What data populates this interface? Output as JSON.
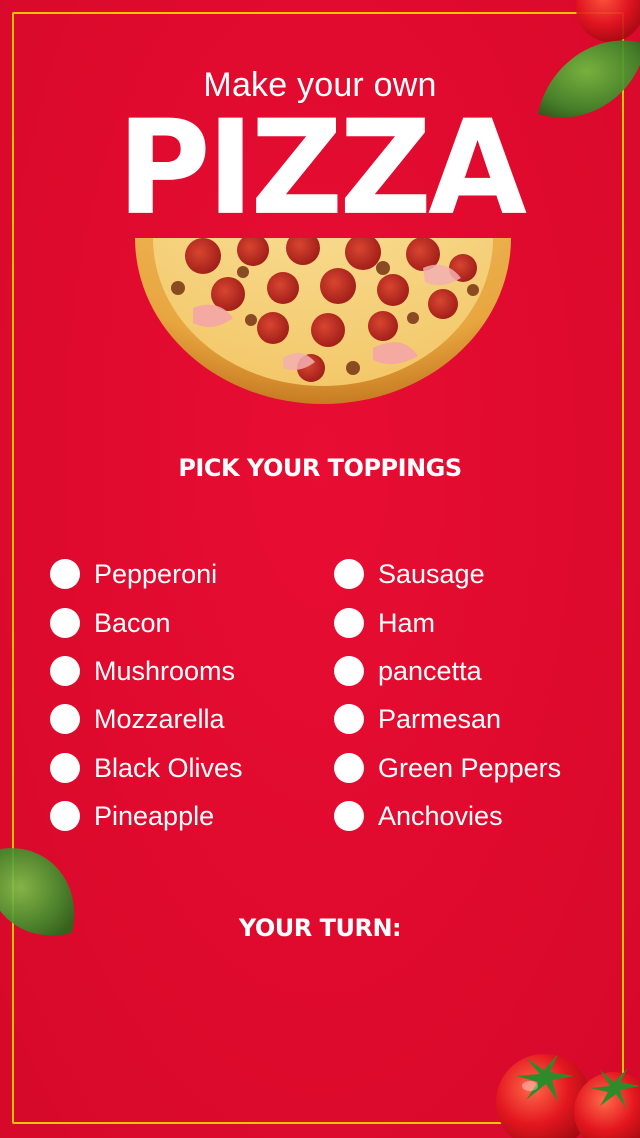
{
  "header": {
    "subtitle": "Make your own",
    "title": "PIZZA"
  },
  "toppings_heading": "PICK YOUR TOPPINGS",
  "toppings": {
    "left": [
      "Pepperoni",
      "Bacon",
      "Mushrooms",
      "Mozzarella",
      "Black Olives",
      "Pineapple"
    ],
    "right": [
      "Sausage",
      "Ham",
      "pancetta",
      "Parmesan",
      "Green Peppers",
      "Anchovies"
    ]
  },
  "your_turn_label": "YOUR TURN:",
  "colors": {
    "background": "#e10b2f",
    "frame": "#f5c400",
    "text": "#ffffff",
    "basil": "#3f8f2b",
    "tomato": "#d91222"
  },
  "icons": {
    "checkbox": "circle-checkbox-icon",
    "basil": "basil-leaf-icon",
    "tomato": "tomato-icon",
    "pizza": "pizza-image"
  }
}
